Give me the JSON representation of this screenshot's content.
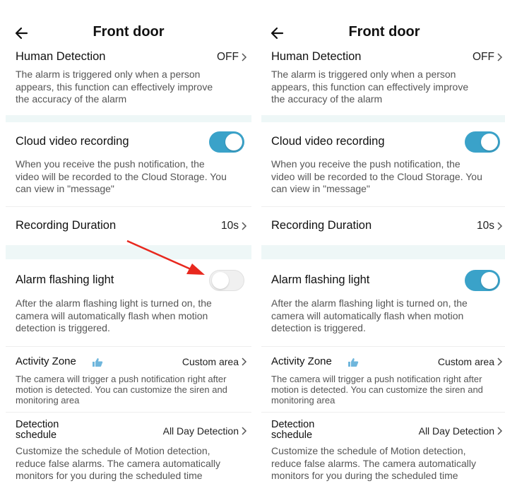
{
  "colors": {
    "accent": "#3aa2c9",
    "section_band": "#eef7f7",
    "annotation_arrow": "#e8281e",
    "toggle_off": "#f0f0f0"
  },
  "screens": [
    {
      "header": {
        "back_icon": "arrow-left-icon",
        "title": "Front door"
      },
      "human_detection": {
        "label": "Human Detection",
        "value": "OFF",
        "desc_lines": [
          "The alarm is triggered only when a person",
          "appears, this function can effectively improve",
          "the accuracy of the alarm"
        ]
      },
      "cloud_recording": {
        "label": "Cloud video recording",
        "enabled": true,
        "desc_lines": [
          "When you receive the push notification, the",
          "video will be recorded to the Cloud Storage. You",
          "can view in \"message\""
        ]
      },
      "recording_duration": {
        "label": "Recording Duration",
        "value": "10s"
      },
      "alarm_light": {
        "label": "Alarm flashing light",
        "enabled": false,
        "desc_lines": [
          "After the alarm flashing light is turned on, the",
          "camera will automatically flash when motion",
          "detection is triggered."
        ]
      },
      "activity_zone": {
        "label": "Activity Zone",
        "icon": "thumbs-up-icon",
        "value": "Custom area",
        "desc_lines": [
          "The camera will trigger a push notification right after",
          "motion is detected. You can customize the siren and",
          "monitoring area"
        ]
      },
      "detection_schedule": {
        "label_lines": [
          "Detection",
          "schedule"
        ],
        "value": "All Day Detection",
        "desc_lines": [
          "Customize the schedule of Motion detection,",
          "reduce false alarms. The camera automatically",
          "monitors for you during the scheduled time"
        ]
      }
    },
    {
      "header": {
        "back_icon": "arrow-left-icon",
        "title": "Front door"
      },
      "human_detection": {
        "label": "Human Detection",
        "value": "OFF",
        "desc_lines": [
          "The alarm is triggered only when a person",
          "appears, this function can effectively improve",
          "the accuracy of the alarm"
        ]
      },
      "cloud_recording": {
        "label": "Cloud video recording",
        "enabled": true,
        "desc_lines": [
          "When you receive the push notification, the",
          "video will be recorded to the Cloud Storage. You",
          "can view in \"message\""
        ]
      },
      "recording_duration": {
        "label": "Recording Duration",
        "value": "10s"
      },
      "alarm_light": {
        "label": "Alarm flashing light",
        "enabled": true,
        "desc_lines": [
          "After the alarm flashing light is turned on, the",
          "camera will automatically flash when motion",
          "detection is triggered."
        ]
      },
      "activity_zone": {
        "label": "Activity Zone",
        "icon": "thumbs-up-icon",
        "value": "Custom area",
        "desc_lines": [
          "The camera will trigger a push notification right after",
          "motion is detected. You can customize the siren and",
          "monitoring area"
        ]
      },
      "detection_schedule": {
        "label_lines": [
          "Detection",
          "schedule"
        ],
        "value": "All Day Detection",
        "desc_lines": [
          "Customize the schedule of Motion detection,",
          "reduce false alarms. The camera automatically",
          "monitors for you during the scheduled time"
        ]
      }
    }
  ]
}
